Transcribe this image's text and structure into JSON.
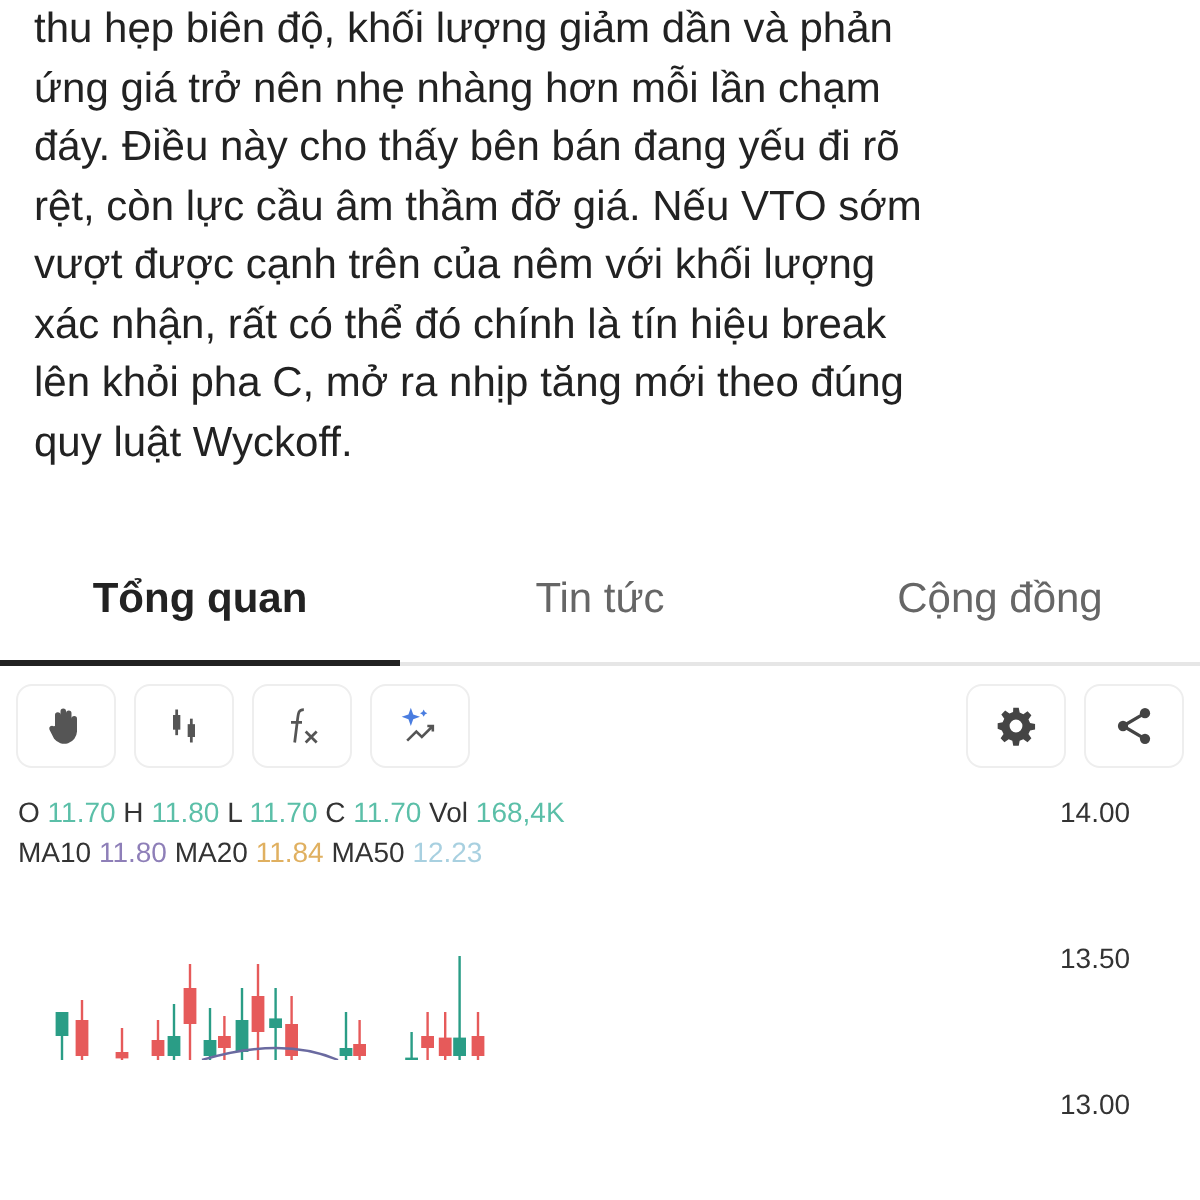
{
  "article": {
    "lines": [
      "thu hẹp biên độ, khối lượng giảm dần và phản",
      "ứng giá trở nên nhẹ nhàng hơn mỗi lần chạm",
      "đáy. Điều này cho thấy bên bán đang yếu đi rõ",
      "rệt, còn lực cầu âm thầm đỡ giá. Nếu VTO sớm",
      "vượt được cạnh trên của nêm với khối lượng",
      "xác nhận, rất có thể đó chính là tín hiệu break",
      "lên khỏi pha C, mở ra nhịp tăng mới theo đúng",
      "quy luật Wyckoff."
    ]
  },
  "tabs": [
    {
      "label": "Tổng quan",
      "selected": true
    },
    {
      "label": "Tin tức",
      "selected": false
    },
    {
      "label": "Cộng đồng",
      "selected": false
    }
  ],
  "toolbar": {
    "left": [
      {
        "kind": "hand"
      },
      {
        "kind": "candles"
      },
      {
        "kind": "fx"
      },
      {
        "kind": "sparkle"
      }
    ],
    "right": [
      {
        "kind": "gear"
      },
      {
        "kind": "share"
      }
    ]
  },
  "chart": {
    "legend": [
      [
        {
          "label": "O",
          "value": "11.70",
          "color": "#5bbfa8"
        },
        {
          "label": "H",
          "value": "11.80",
          "color": "#5bbfa8"
        },
        {
          "label": "L",
          "value": "11.70",
          "color": "#5bbfa8"
        },
        {
          "label": "C",
          "value": "11.70",
          "color": "#5bbfa8"
        },
        {
          "label": "Vol",
          "value": "168,4K",
          "color": "#5bbfa8"
        }
      ],
      [
        {
          "label": "MA10",
          "value": "11.80",
          "color": "#8e7fb8"
        },
        {
          "label": "MA20",
          "value": "11.84",
          "color": "#e0b060"
        },
        {
          "label": "MA50",
          "value": "12.23",
          "color": "#a8d0e0"
        }
      ]
    ],
    "price_labels": [
      "14.00",
      "13.50",
      "13.00"
    ]
  }
}
